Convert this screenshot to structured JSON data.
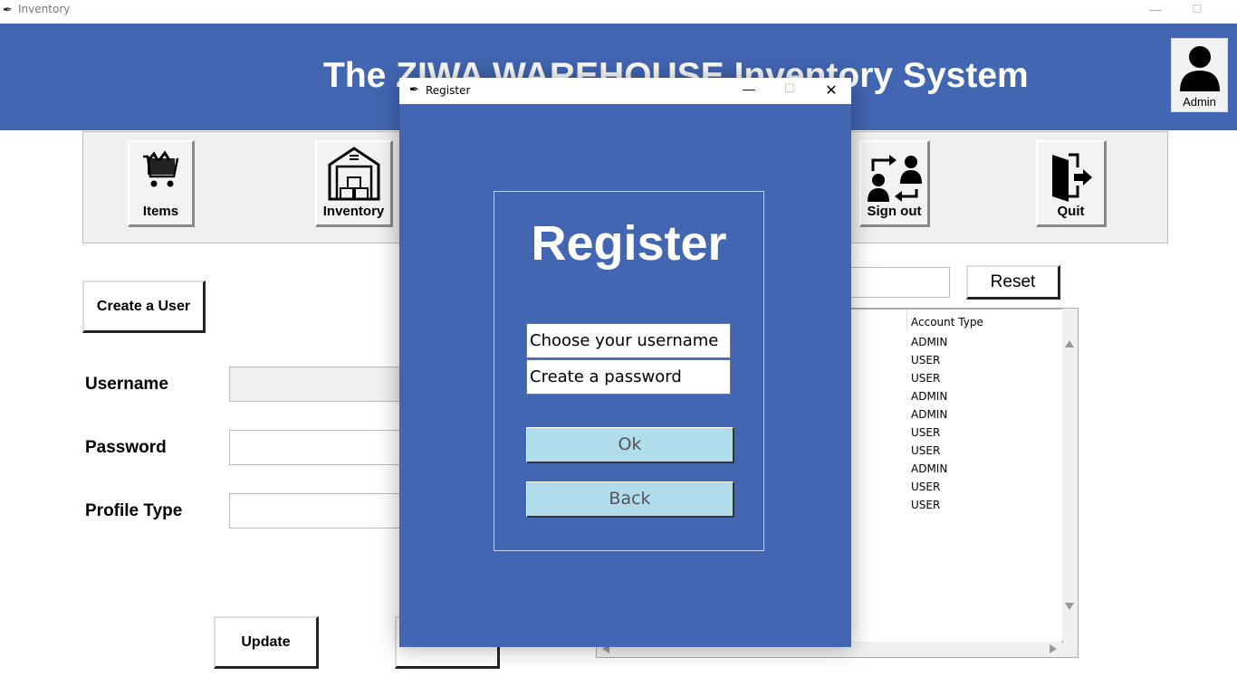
{
  "window": {
    "title": "Inventory",
    "controls": [
      "—",
      "☐",
      "✕"
    ]
  },
  "header": {
    "title": "The ZIWA WAREHOUSE Inventory System",
    "user_label": "Admin"
  },
  "toolbar": {
    "items_label": "Items",
    "inventory_label": "Inventory",
    "signout_label": "Sign out",
    "quit_label": "Quit"
  },
  "form": {
    "create_user_label": "Create a User",
    "username_label": "Username",
    "password_label": "Password",
    "profile_type_label": "Profile Type",
    "update_label": "Update",
    "reset_label": "Reset"
  },
  "table": {
    "column_header": "Account Type",
    "rows": [
      "ADMIN",
      "USER",
      "USER",
      "ADMIN",
      "ADMIN",
      "USER",
      "USER",
      "ADMIN",
      "USER",
      "USER"
    ]
  },
  "dialog": {
    "title": "Register",
    "heading": "Register",
    "username_placeholder": "Choose your username",
    "password_placeholder": "Create a password",
    "ok_label": "Ok",
    "back_label": "Back",
    "controls": [
      "—",
      "☐",
      "✕"
    ]
  },
  "colors": {
    "brand_blue": "#4366b3",
    "button_light_blue": "#b0dcec"
  }
}
